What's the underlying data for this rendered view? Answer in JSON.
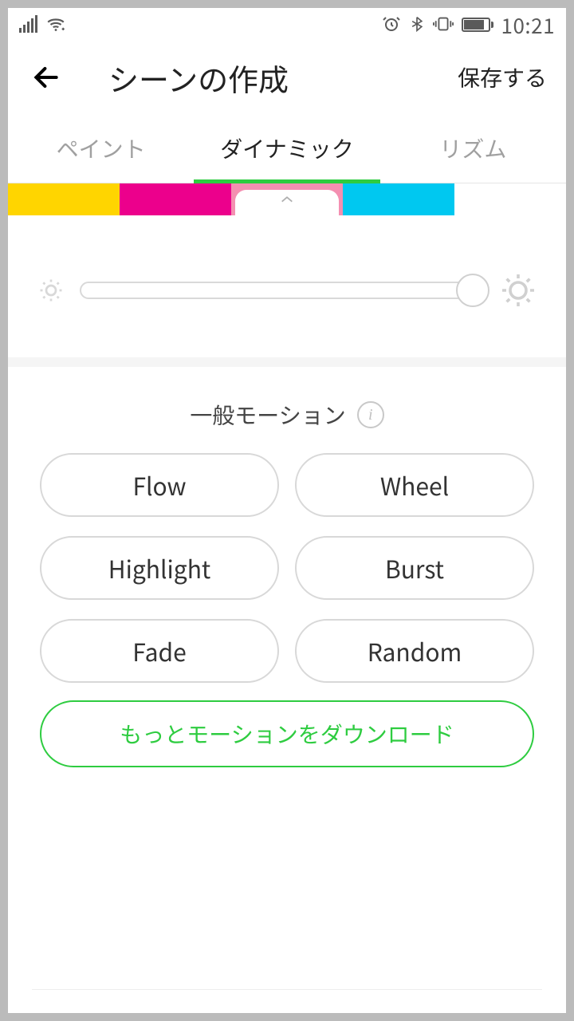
{
  "status": {
    "time": "10:21"
  },
  "header": {
    "title": "シーンの作成",
    "save": "保存する"
  },
  "tabs": {
    "paint": "ペイント",
    "dynamic": "ダイナミック",
    "rhythm": "リズム"
  },
  "colors": {
    "swatches": [
      "#ffd500",
      "#ec008c",
      "#f48fb1",
      "#00c8f0"
    ],
    "selected_index": 2
  },
  "brightness": {
    "value_pct": 100
  },
  "motions": {
    "section_label": "一般モーション",
    "options": [
      "Flow",
      "Wheel",
      "Highlight",
      "Burst",
      "Fade",
      "Random"
    ],
    "download": "もっとモーションをダウンロード"
  }
}
